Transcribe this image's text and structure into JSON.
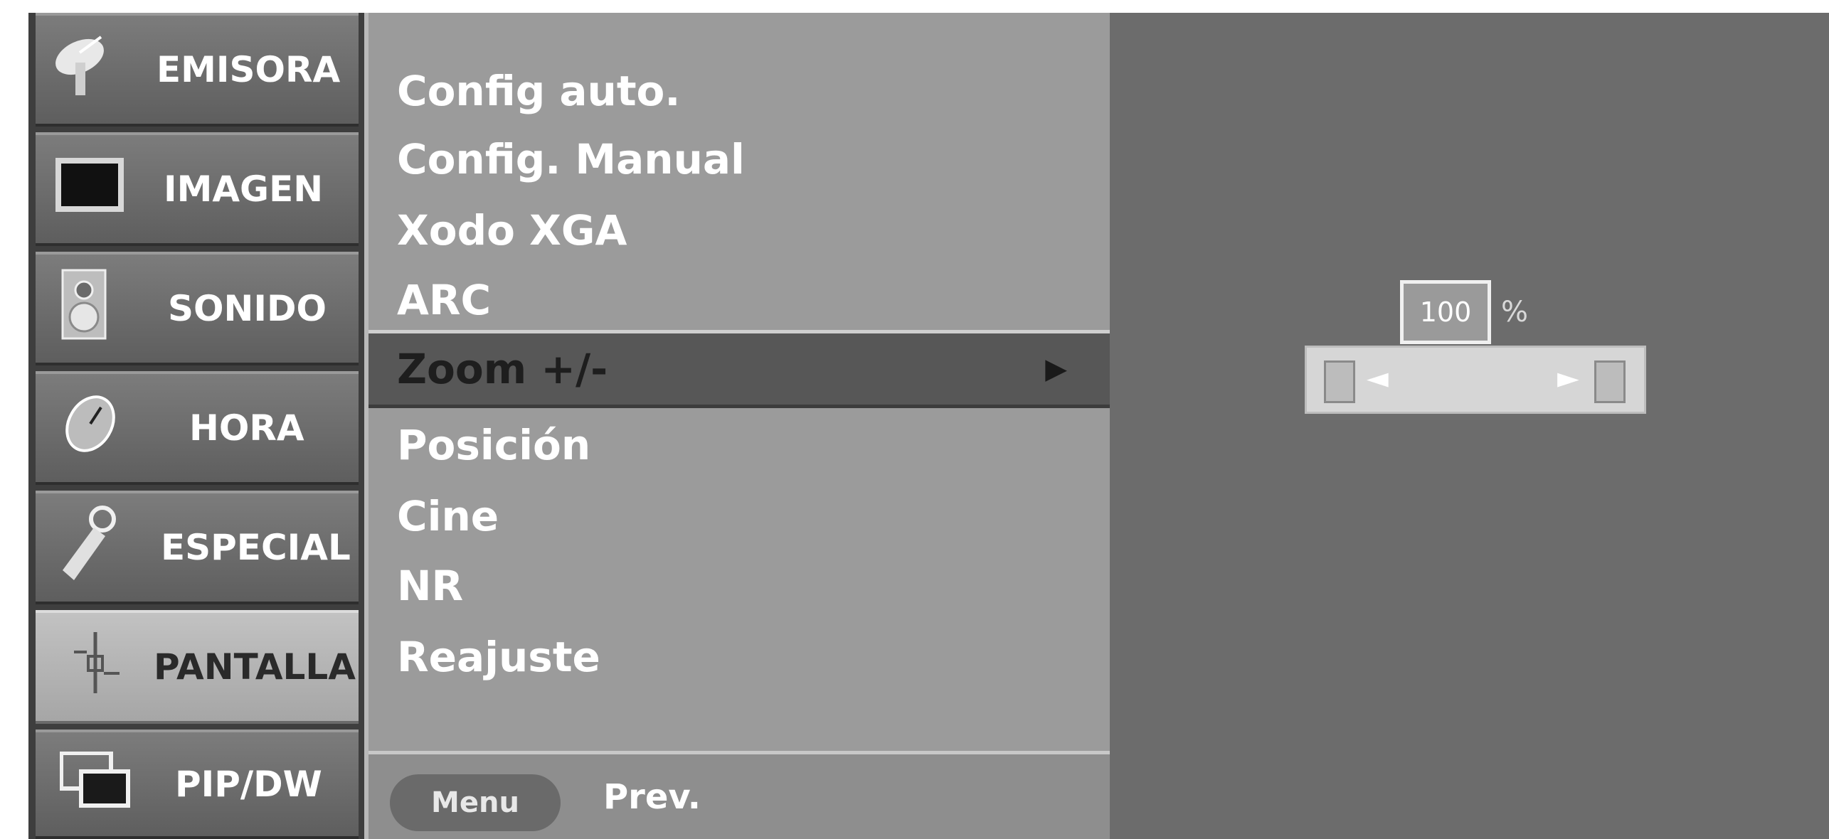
{
  "categories": [
    {
      "label": "EMISORA",
      "icon": "satellite-dish-icon",
      "active": false
    },
    {
      "label": "IMAGEN",
      "icon": "picture-icon",
      "active": false
    },
    {
      "label": "SONIDO",
      "icon": "speaker-icon",
      "active": false
    },
    {
      "label": "HORA",
      "icon": "clock-icon",
      "active": false
    },
    {
      "label": "ESPECIAL",
      "icon": "key-icon",
      "active": false
    },
    {
      "label": "PANTALLA",
      "icon": "screen-adjust-icon",
      "active": true
    },
    {
      "label": "PIP/DW",
      "icon": "pip-icon",
      "active": false
    }
  ],
  "menu": {
    "items": [
      {
        "label": "Config auto."
      },
      {
        "label": "Config. Manual"
      },
      {
        "label": "Xodo XGA"
      },
      {
        "label": "ARC"
      },
      {
        "label": "Zoom +/-",
        "selected": true,
        "arrow": "▶"
      },
      {
        "label": "Posición"
      },
      {
        "label": "Cine"
      },
      {
        "label": "NR"
      },
      {
        "label": "Reajuste"
      }
    ],
    "footer": {
      "button_label": "Menu",
      "prev_label": "Prev."
    }
  },
  "zoom": {
    "value": "100",
    "unit": "%",
    "left_arrow": "◄",
    "right_arrow": "►"
  },
  "colors": {
    "panel_bg": "#9b9b9b",
    "selected_bg": "#575757",
    "preview_bg": "#6c6c6c"
  }
}
